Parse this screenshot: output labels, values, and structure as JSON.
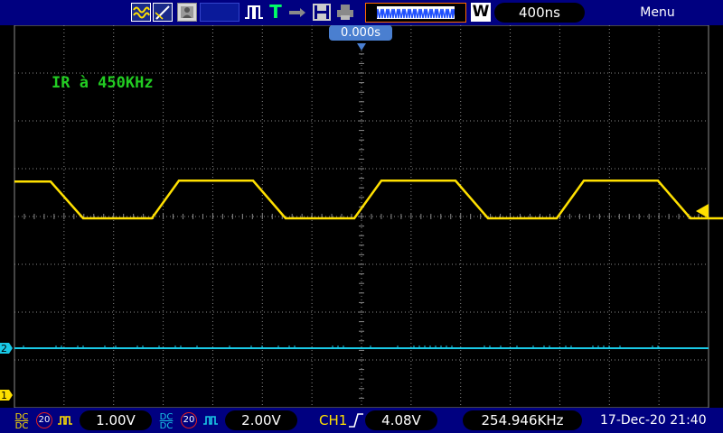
{
  "toolbar": {
    "icons": [
      "wave-mode-icon",
      "cursor-icon",
      "person-icon",
      "blank-icon",
      "pulse-icon",
      "trigger-icon",
      "arrow-icon",
      "save-icon",
      "print-icon",
      "waveform-strip-icon",
      "w-icon"
    ],
    "trigger_letter": "T",
    "w_letter": "W",
    "timebase": "400ns",
    "menu": "Menu"
  },
  "display": {
    "trigger_position": "0.000s",
    "annotation": "IR à 450KHz",
    "ch1_marker": "1",
    "ch2_marker": "2",
    "colors": {
      "ch1": "#ffe000",
      "ch2": "#19c9e6",
      "grid": "#8a8a8a",
      "annotation": "#22cc22",
      "bar": "#000080"
    }
  },
  "chart_data": {
    "type": "line",
    "series": [
      {
        "channel": "CH1",
        "waveform": "trapezoid",
        "high_div": 1.0,
        "low_div": 0.0,
        "edge_div": 0.6,
        "period_div": 2.45
      },
      {
        "channel": "CH2",
        "waveform": "flat",
        "level_div": -3.7
      }
    ]
  },
  "status": {
    "ch1": {
      "coupling_top": "DC",
      "coupling_bottom": "DC",
      "bw_limit": "20",
      "volts": "1.00V"
    },
    "ch2": {
      "coupling_top": "DC",
      "coupling_bottom": "DC",
      "bw_limit": "20",
      "volts": "2.00V"
    },
    "trigger_source": "CH1",
    "trigger_level": "4.08V",
    "frequency": "254.946KHz",
    "datetime": "17-Dec-20 21:40"
  }
}
